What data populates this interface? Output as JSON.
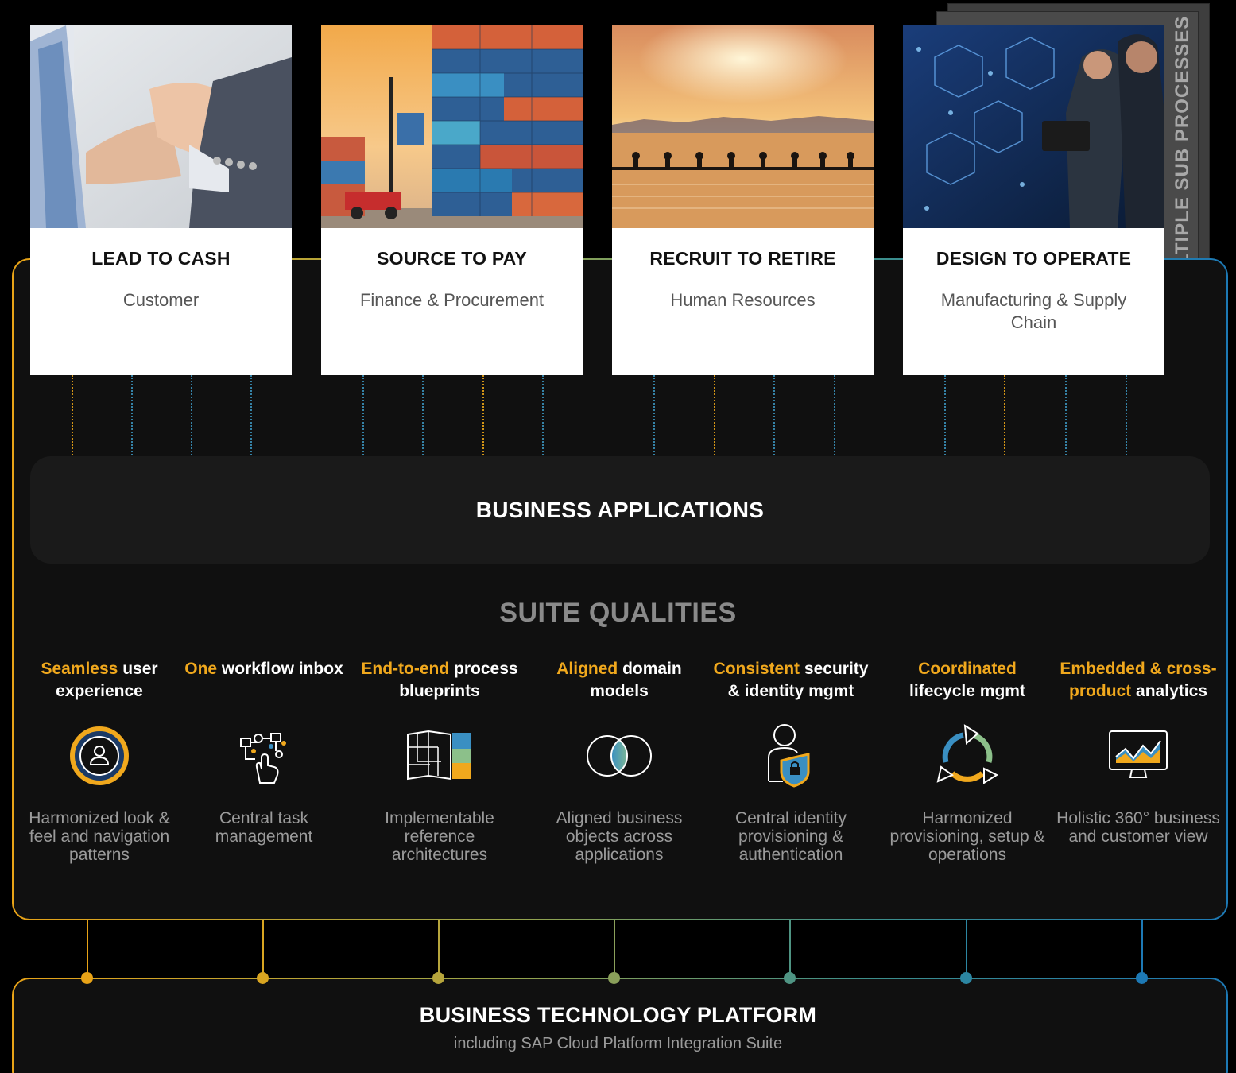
{
  "processes": [
    {
      "title": "LEAD TO CASH",
      "subtitle": "Customer",
      "photo": "handshake-photo"
    },
    {
      "title": "SOURCE TO PAY",
      "subtitle": "Finance & Procurement",
      "photo": "shipping-containers-photo"
    },
    {
      "title": "RECRUIT TO RETIRE",
      "subtitle": "Human Resources",
      "photo": "rowing-team-sunset-photo"
    },
    {
      "title": "DESIGN TO OPERATE",
      "subtitle": "Manufacturing & Supply Chain",
      "photo": "engineers-technology-photo"
    }
  ],
  "side_label": "AND MULTIPLE SUB PROCESSES",
  "business_applications": "BUSINESS APPLICATIONS",
  "suite_qualities_title": "SUITE QUALITIES",
  "qualities": [
    {
      "highlight": "Seamless",
      "rest": "user experience",
      "description": "Harmonized look & feel and navigation patterns",
      "icon": "user-circle-icon"
    },
    {
      "highlight": "One",
      "rest": "workflow inbox",
      "description": "Central task management",
      "icon": "workflow-hand-icon"
    },
    {
      "highlight": "End-to-end",
      "rest": "process blueprints",
      "description": "Implementable reference architectures",
      "icon": "map-blueprint-icon"
    },
    {
      "highlight": "Aligned",
      "rest": "domain models",
      "description": "Aligned business objects across applications",
      "icon": "overlapping-circles-icon"
    },
    {
      "highlight": "Consistent",
      "rest": "security & identity mgmt",
      "description": "Central identity provisioning & authentication",
      "icon": "user-shield-lock-icon"
    },
    {
      "highlight": "Coordinated",
      "rest": "lifecycle mgmt",
      "description": "Harmonized provisioning, setup & operations",
      "icon": "lifecycle-arrows-icon"
    },
    {
      "highlight": "Embedded & cross-product",
      "rest": "analytics",
      "description": "Holistic 360° business and customer view",
      "icon": "monitor-analytics-icon"
    }
  ],
  "platform": {
    "title": "BUSINESS TECHNOLOGY PLATFORM",
    "subtitle": "including SAP Cloud Platform Integration Suite"
  },
  "colors": {
    "background": "#000000",
    "panel": "#101010",
    "highlight": "#f0a81d",
    "gradient_start": "#e8a317",
    "gradient_end": "#1d79b5"
  }
}
